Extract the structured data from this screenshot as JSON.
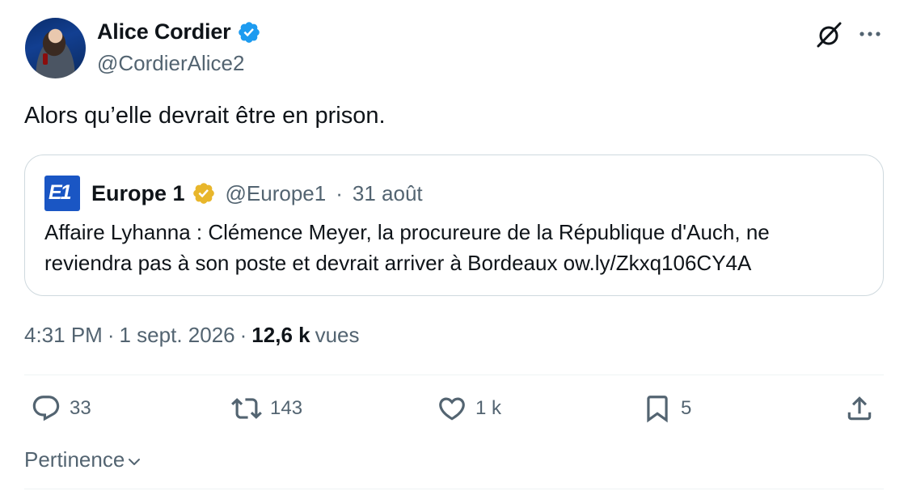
{
  "author": {
    "name": "Alice Cordier",
    "handle": "@CordierAlice2",
    "verified": true,
    "verified_color": "#1d9bf0"
  },
  "header_icons": [
    "grok-icon",
    "more-icon"
  ],
  "tweet": {
    "text": "Alors qu’elle devrait être en prison."
  },
  "quote": {
    "logo_text": "E1",
    "logo_color": "#1a56c4",
    "name": "Europe 1",
    "verified_color": "#e8b62b",
    "handle": "@Europe1",
    "separator": "·",
    "date": "31 août",
    "text": "Affaire Lyhanna : Clémence Meyer, la procureure de la République d'Auch, ne reviendra pas à son poste et devrait arriver à Bordeaux ow.ly/Zkxq106CY4A"
  },
  "meta": {
    "time": "4:31 PM",
    "sep1": "·",
    "date": "1 sept. 2026",
    "sep2": "·",
    "views_count": "12,6 k",
    "views_label": "vues"
  },
  "actions": {
    "replies": "33",
    "reposts": "143",
    "likes": "1 k",
    "bookmarks": "5"
  },
  "sort": {
    "label": "Pertinence"
  },
  "colors": {
    "text": "#0f1419",
    "secondary": "#536471",
    "border": "#cfd9de"
  }
}
